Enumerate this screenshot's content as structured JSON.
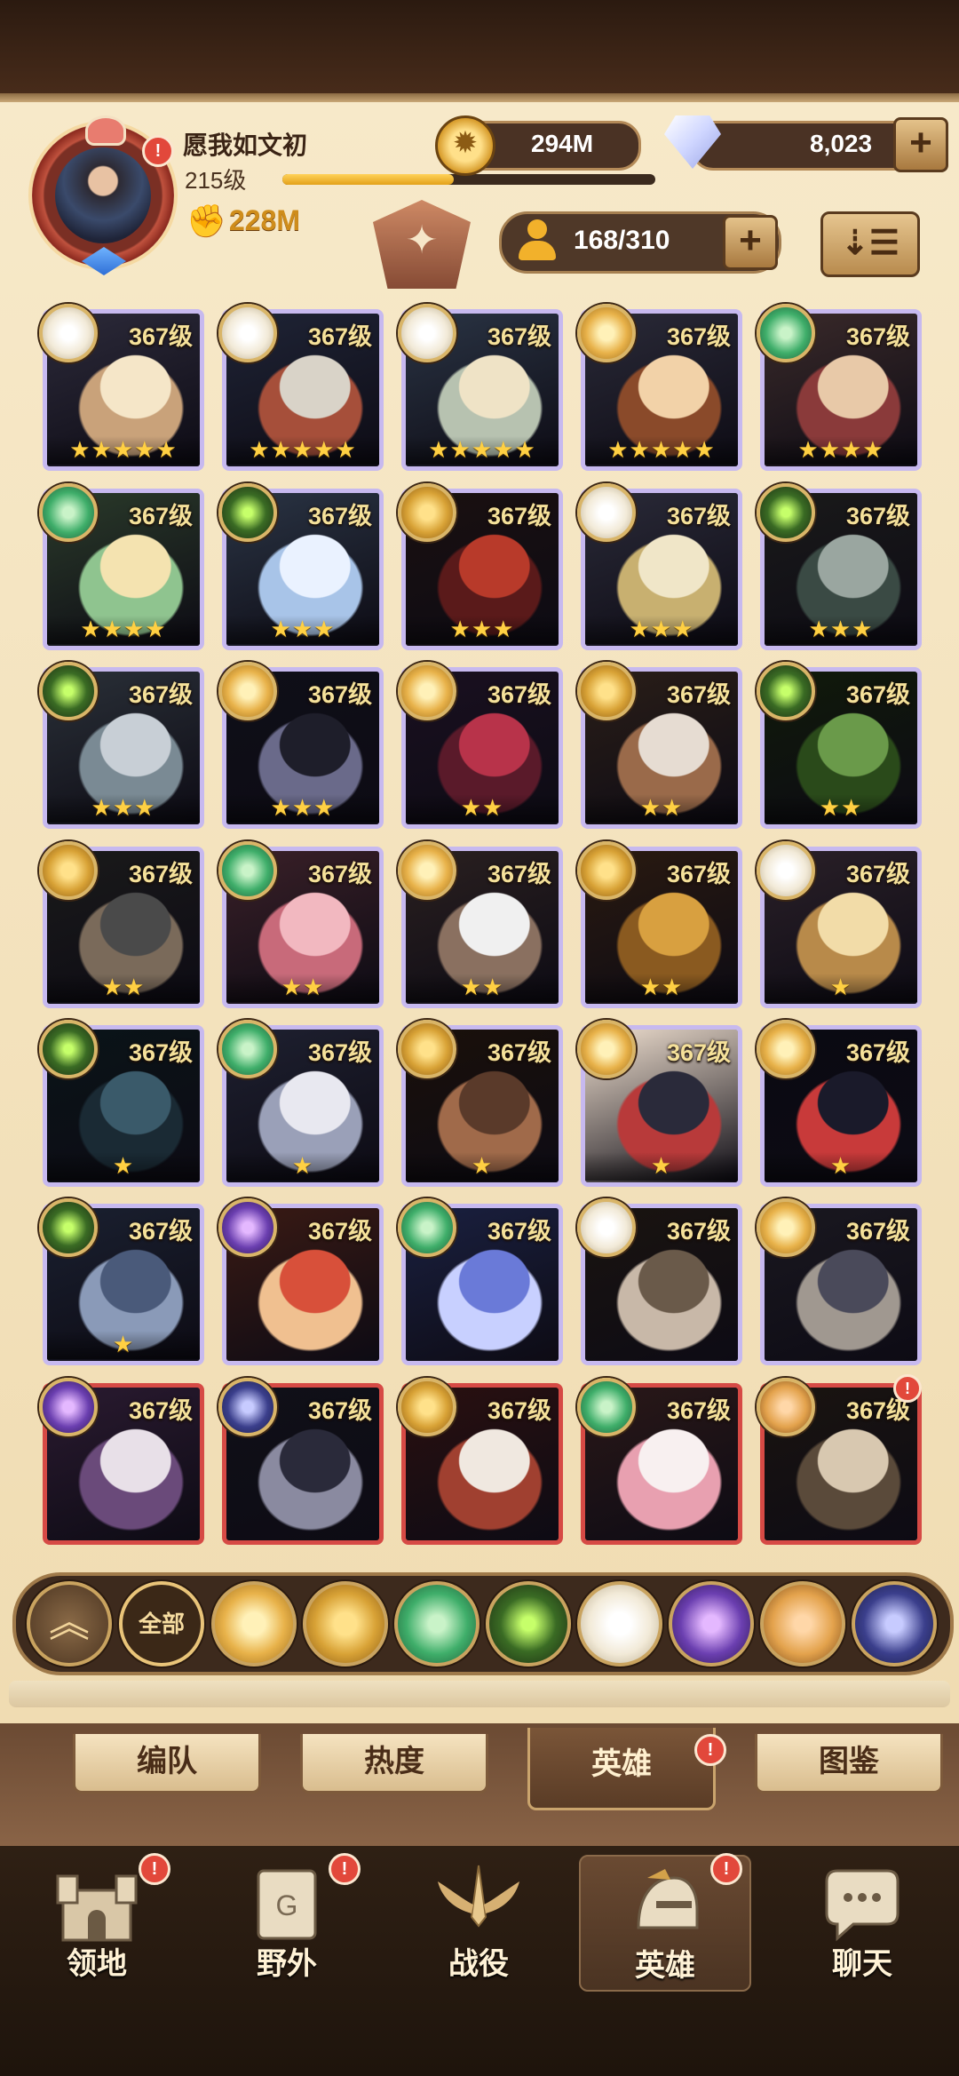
{
  "player": {
    "name": "愿我如文初",
    "level": "215级",
    "xp_fraction": 0.46,
    "power": "228M",
    "gold": "294M",
    "diamonds": "8,023",
    "hero_count": "168/310"
  },
  "heroes": [
    {
      "level": "367级",
      "stars": "★★★★★",
      "faction": "celestial",
      "frame": "purple"
    },
    {
      "level": "367级",
      "stars": "★★★★★",
      "faction": "celestial",
      "frame": "purple"
    },
    {
      "level": "367级",
      "stars": "★★★★★",
      "faction": "celestial",
      "frame": "purple"
    },
    {
      "level": "367级",
      "stars": "★★★★★",
      "faction": "lightbearer",
      "frame": "purple"
    },
    {
      "level": "367级",
      "stars": "★★★★",
      "faction": "wilder",
      "frame": "purple"
    },
    {
      "level": "367级",
      "stars": "★★★★",
      "faction": "wilder",
      "frame": "purple"
    },
    {
      "level": "367级",
      "stars": "★★★",
      "faction": "graveborn",
      "frame": "purple"
    },
    {
      "level": "367级",
      "stars": "★★★",
      "faction": "mauler",
      "frame": "purple"
    },
    {
      "level": "367级",
      "stars": "★★★",
      "faction": "celestial",
      "frame": "purple"
    },
    {
      "level": "367级",
      "stars": "★★★",
      "faction": "graveborn",
      "frame": "purple"
    },
    {
      "level": "367级",
      "stars": "★★★",
      "faction": "graveborn",
      "frame": "purple"
    },
    {
      "level": "367级",
      "stars": "★★★",
      "faction": "lightbearer",
      "frame": "purple"
    },
    {
      "level": "367级",
      "stars": "★★",
      "faction": "lightbearer",
      "frame": "purple"
    },
    {
      "level": "367级",
      "stars": "★★",
      "faction": "mauler",
      "frame": "purple"
    },
    {
      "level": "367级",
      "stars": "★★",
      "faction": "graveborn",
      "frame": "purple"
    },
    {
      "level": "367级",
      "stars": "★★",
      "faction": "mauler",
      "frame": "purple"
    },
    {
      "level": "367级",
      "stars": "★★",
      "faction": "wilder",
      "frame": "purple"
    },
    {
      "level": "367级",
      "stars": "★★",
      "faction": "lightbearer",
      "frame": "purple"
    },
    {
      "level": "367级",
      "stars": "★★",
      "faction": "mauler",
      "frame": "purple"
    },
    {
      "level": "367级",
      "stars": "★",
      "faction": "celestial",
      "frame": "purple"
    },
    {
      "level": "367级",
      "stars": "★",
      "faction": "graveborn",
      "frame": "purple"
    },
    {
      "level": "367级",
      "stars": "★",
      "faction": "wilder",
      "frame": "purple"
    },
    {
      "level": "367级",
      "stars": "★",
      "faction": "mauler",
      "frame": "purple"
    },
    {
      "level": "367级",
      "stars": "★",
      "faction": "lightbearer",
      "frame": "purple"
    },
    {
      "level": "367级",
      "stars": "★",
      "faction": "lightbearer",
      "frame": "purple"
    },
    {
      "level": "367级",
      "stars": "★",
      "faction": "graveborn",
      "frame": "purple"
    },
    {
      "level": "367级",
      "stars": "",
      "faction": "hypogean",
      "frame": "purple"
    },
    {
      "level": "367级",
      "stars": "",
      "faction": "wilder",
      "frame": "purple"
    },
    {
      "level": "367级",
      "stars": "",
      "faction": "celestial",
      "frame": "purple"
    },
    {
      "level": "367级",
      "stars": "",
      "faction": "lightbearer",
      "frame": "purple"
    },
    {
      "level": "367级",
      "stars": "",
      "faction": "hypogean",
      "frame": "red"
    },
    {
      "level": "367级",
      "stars": "",
      "faction": "void",
      "frame": "red"
    },
    {
      "level": "367级",
      "stars": "",
      "faction": "mauler",
      "frame": "red"
    },
    {
      "level": "367级",
      "stars": "",
      "faction": "wilder",
      "frame": "red"
    },
    {
      "level": "367级",
      "stars": "",
      "faction": "dimensional",
      "frame": "red",
      "badge": "!"
    }
  ],
  "faction_filters": {
    "collapse_label": "︽",
    "all_label": "全部",
    "icons": [
      "lightbearer-icon",
      "mauler-icon",
      "wilder-icon",
      "graveborn-icon",
      "celestial-icon",
      "hypogean-icon",
      "dimensional-icon",
      "void-icon"
    ]
  },
  "subtabs": [
    "编队",
    "热度",
    "英雄",
    "图鉴"
  ],
  "nav": [
    "领地",
    "野外",
    "战役",
    "英雄",
    "聊天"
  ],
  "badge_text": "!",
  "colors": {
    "lightbearer": "#e8b24a",
    "mauler": "#d8a236",
    "wilder": "#3fae6a",
    "graveborn": "#3a6b24",
    "celestial": "#f2ead8",
    "hypogean": "#6b3fb0",
    "dimensional": "#e3a24c",
    "void": "#3b3f8c"
  }
}
